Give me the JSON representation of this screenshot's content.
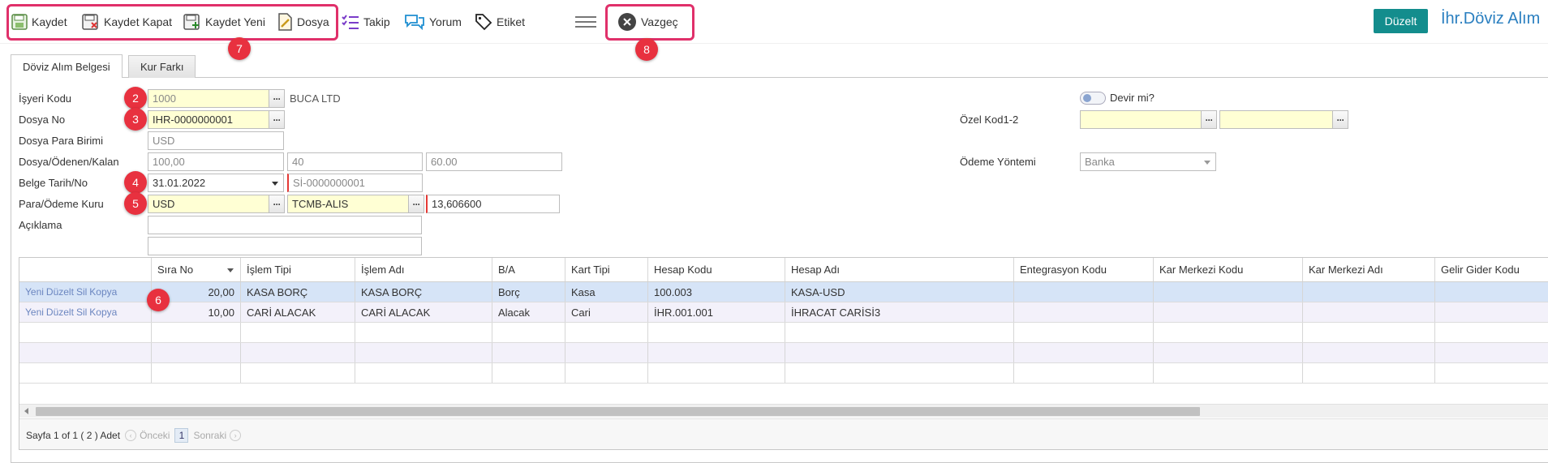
{
  "toolbar": {
    "save": "Kaydet",
    "save_close": "Kaydet Kapat",
    "save_new": "Kaydet Yeni",
    "file": "Dosya",
    "track": "Takip",
    "comment": "Yorum",
    "tag": "Etiket",
    "cancel": "Vazgeç",
    "edit": "Düzelt",
    "title": "İhr.Döviz Alım"
  },
  "badges": [
    "2",
    "3",
    "4",
    "5",
    "6",
    "7",
    "8"
  ],
  "tabs": [
    "Döviz Alım Belgesi",
    "Kur Farkı"
  ],
  "form": {
    "labels": {
      "workplace": "İşyeri Kodu",
      "file_no": "Dosya No",
      "file_currency": "Dosya Para Birimi",
      "file_paid_remaining": "Dosya/Ödenen/Kalan",
      "doc_date_no": "Belge Tarih/No",
      "currency_rate": "Para/Ödeme Kuru",
      "description": "Açıklama",
      "transfer": "Devir mi?",
      "special_code": "Özel Kod1-2",
      "payment_method": "Ödeme Yöntemi"
    },
    "workplace_code": "1000",
    "workplace_name": "BUCA LTD",
    "file_no": "IHR-0000000001",
    "file_currency": "USD",
    "file_amount": "100,00",
    "paid_amount": "40",
    "remaining_amount": "60.00",
    "doc_date": "31.01.2022",
    "doc_no": "Sİ-0000000001",
    "currency": "USD",
    "rate_type": "TCMB-ALIS",
    "rate_value": "13,606600",
    "description_1": "",
    "description_2": "",
    "special_code_1": "",
    "special_code_2": "",
    "payment_method": "Banka"
  },
  "grid": {
    "columns": [
      "Sıra No",
      "İşlem Tipi",
      "İşlem Adı",
      "B/A",
      "Kart Tipi",
      "Hesap Kodu",
      "Hesap Adı",
      "Entegrasyon Kodu",
      "Kar Merkezi Kodu",
      "Kar Merkezi Adı",
      "Gelir Gider Kodu"
    ],
    "row_actions": [
      "Yeni",
      "Düzelt",
      "Sil",
      "Kopya"
    ],
    "rows": [
      [
        "20,00",
        "KASA BORÇ",
        "KASA BORÇ",
        "Borç",
        "Kasa",
        "100.003",
        "KASA-USD",
        "",
        "",
        "",
        ""
      ],
      [
        "10,00",
        "CARİ ALACAK",
        "CARİ ALACAK",
        "Alacak",
        "Cari",
        "İHR.001.001",
        "İHRACAT CARİSİ3",
        "",
        "",
        "",
        ""
      ]
    ],
    "pager": {
      "summary": "Sayfa 1 of 1 ( 2 ) Adet",
      "prev": "Önceki",
      "page": "1",
      "next": "Sonraki"
    }
  },
  "colors": {
    "highlight": "#e0306a",
    "badge": "#e8313f",
    "accent": "#138d8d",
    "title": "#2a7fc0",
    "required_field": "#ffffd4"
  },
  "icons": [
    "save-icon",
    "save-close-icon",
    "save-new-icon",
    "file-icon",
    "track-icon",
    "comment-icon",
    "tag-icon",
    "menu-icon",
    "cancel-icon"
  ]
}
